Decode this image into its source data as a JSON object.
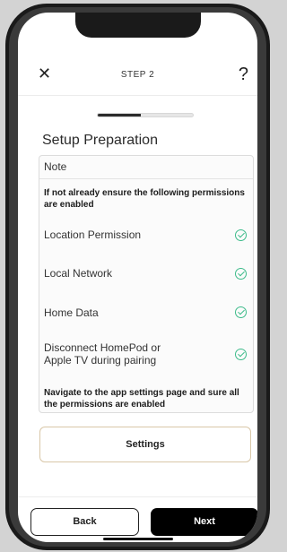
{
  "header": {
    "close_glyph": "✕",
    "step_title": "STEP 2",
    "help_glyph": "?"
  },
  "progress": {
    "value_percent": 45
  },
  "section_title": "Setup Preparation",
  "note": {
    "label": "Note",
    "intro": "If not already ensure the following permissions are enabled",
    "permissions": [
      {
        "label": "Location Permission",
        "status_icon": "check-circle-icon"
      },
      {
        "label": "Local Network",
        "status_icon": "check-circle-icon"
      },
      {
        "label": "Home Data",
        "status_icon": "check-circle-icon"
      },
      {
        "label": "Disconnect HomePod or Apple TV during pairing",
        "status_icon": "check-circle-icon"
      }
    ],
    "outro": "Navigate to the app settings page and sure all the permissions are enabled"
  },
  "settings_button": "Settings",
  "footer": {
    "back_label": "Back",
    "next_label": "Next"
  },
  "colors": {
    "check": "#3dbb8a",
    "primary_button": "#000000",
    "settings_border": "#d9c7a8"
  }
}
